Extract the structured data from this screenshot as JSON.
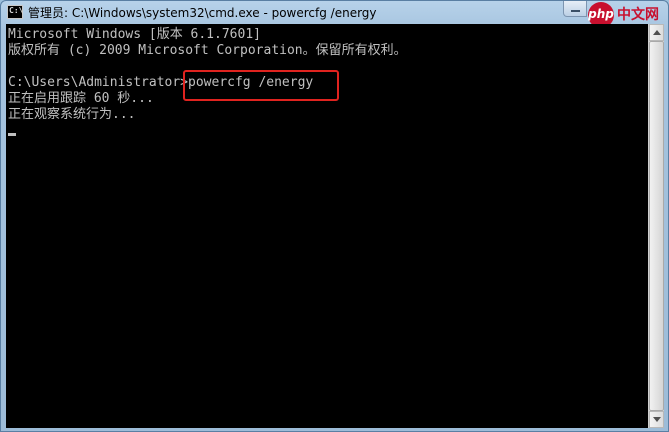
{
  "window": {
    "title": "管理员: C:\\Windows\\system32\\cmd.exe - powercfg  /energy",
    "icon_text": "C:\\"
  },
  "watermark": {
    "badge": "php",
    "text": "中文网"
  },
  "console": {
    "lines": [
      "Microsoft Windows [版本 6.1.7601]",
      "版权所有 (c) 2009 Microsoft Corporation。保留所有权利。",
      "",
      "C:\\Users\\Administrator>powercfg /energy",
      "正在启用跟踪 60 秒...",
      "正在观察系统行为..."
    ],
    "text_color": "#c0c0c0",
    "background": "#000000"
  },
  "highlight": {
    "color": "#e0231f"
  }
}
